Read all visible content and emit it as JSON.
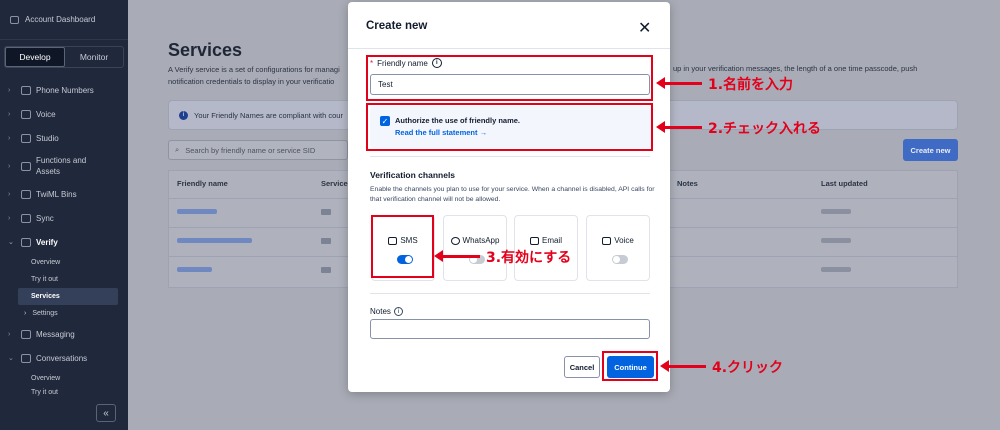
{
  "sidebar": {
    "top_link": "Account Dashboard",
    "tabs": [
      "Develop",
      "Monitor"
    ],
    "items": [
      {
        "label": "Phone Numbers"
      },
      {
        "label": "Voice"
      },
      {
        "label": "Studio"
      },
      {
        "label_line1": "Functions and",
        "label_line2": "Assets"
      },
      {
        "label": "TwiML Bins"
      },
      {
        "label": "Sync"
      },
      {
        "label": "Verify"
      },
      {
        "label": "Messaging"
      },
      {
        "label": "Conversations"
      }
    ],
    "verify_sub": [
      "Overview",
      "Try it out",
      "Services",
      "Settings"
    ],
    "conversations_sub": [
      "Overview",
      "Try it out"
    ],
    "collapse_icon": "«"
  },
  "main": {
    "title": "Services",
    "description_line1": "A Verify service is a set of configurations for managi",
    "description_line2": "notification credentials to display in your verificatio",
    "description_right": "up in your verification messages, the length of a one time passcode, push",
    "banner": "Your Friendly Names are compliant with cour",
    "search_placeholder": "Search by friendly name or service SID",
    "create_button": "Create new",
    "table_headers": [
      "Friendly name",
      "Service",
      "Notes",
      "Last updated"
    ]
  },
  "modal": {
    "title": "Create new",
    "close": "✕",
    "friendly_name_label": "Friendly name",
    "friendly_name_value": "Test",
    "authorize_text": "Authorize the use of friendly name.",
    "authorize_link": "Read the full statement →",
    "verification_title": "Verification channels",
    "verification_desc": "Enable the channels you plan to use for your service. When a channel is disabled, API calls for that verification channel will not be allowed.",
    "channels": [
      {
        "label": "SMS",
        "enabled": true
      },
      {
        "label": "WhatsApp",
        "enabled": false
      },
      {
        "label": "Email",
        "enabled": false
      },
      {
        "label": "Voice",
        "enabled": false
      }
    ],
    "notes_label": "Notes",
    "cancel_button": "Cancel",
    "continue_button": "Continue"
  },
  "annotations": {
    "step1": "1.名前を入力",
    "step2": "2.チェック入れる",
    "step3": "3.有効にする",
    "step4": "4.クリック",
    "color": "#e3001b"
  }
}
